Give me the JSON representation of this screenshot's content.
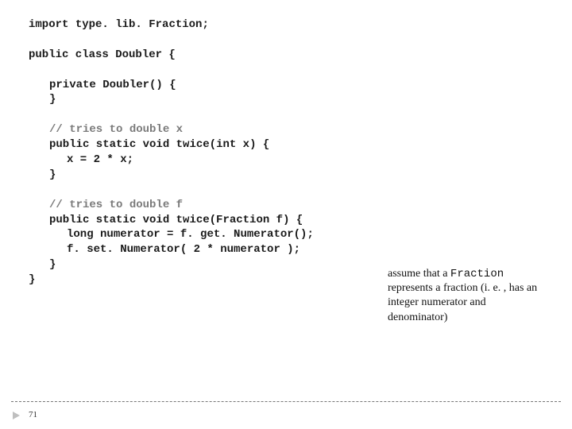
{
  "code": {
    "l1a": "import",
    "l1b": " type. lib. Fraction;",
    "l3a": "public class ",
    "l3b": "Doubler",
    "l3c": " {",
    "l5a": "private ",
    "l5b": "Doubler() {",
    "l6": "}",
    "l8": "// tries to double x",
    "l9a": "public static void ",
    "l9b": "twice(",
    "l9c": "int ",
    "l9d": "x) {",
    "l10": "x = 2 * x;",
    "l11": "}",
    "l13": "// tries to double f",
    "l14a": "public static void ",
    "l14b": "twice(Fraction f) {",
    "l15a": "long ",
    "l15b": "numerator = f. get. Numerator();",
    "l16": "f. set. Numerator( 2 * numerator );",
    "l17": "}",
    "l18": "}"
  },
  "note": {
    "t1": "assume that a ",
    "mono": "Fraction",
    "t2": " represents a fraction (i. e. , has an integer numerator and denominator)"
  },
  "page": "71"
}
